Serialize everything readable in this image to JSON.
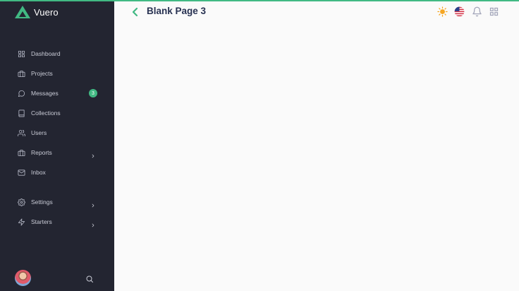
{
  "app": {
    "name": "Vuero"
  },
  "header": {
    "title": "Blank Page 3"
  },
  "sidebar": {
    "items": [
      {
        "label": "Dashboard",
        "icon": "grid-icon"
      },
      {
        "label": "Projects",
        "icon": "briefcase-icon"
      },
      {
        "label": "Messages",
        "icon": "message-circle-icon",
        "badge": "3"
      },
      {
        "label": "Collections",
        "icon": "book-icon"
      },
      {
        "label": "Users",
        "icon": "users-icon"
      },
      {
        "label": "Reports",
        "icon": "briefcase-icon",
        "has_submenu": true
      },
      {
        "label": "Inbox",
        "icon": "mail-icon"
      },
      {
        "label": "Settings",
        "icon": "settings-icon",
        "has_submenu": true
      },
      {
        "label": "Starters",
        "icon": "zap-icon",
        "has_submenu": true
      }
    ]
  },
  "colors": {
    "accent": "#41b983",
    "sidebar_bg": "#232531",
    "title": "#283252",
    "sun": "#f5a623"
  }
}
